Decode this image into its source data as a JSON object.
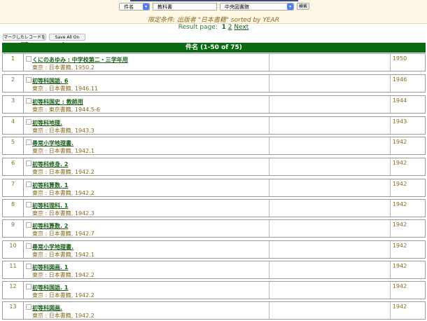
{
  "search": {
    "field_select": "件名",
    "query_value": "教科書",
    "library_select": "中央図書館",
    "search_button": "検索"
  },
  "query_line": "限定条件: 出版者 \"日本書籍\" sorted by YEAR",
  "result_page": {
    "label": "Result page:",
    "current": "1",
    "page2": "2",
    "next": "Next"
  },
  "actions": {
    "save_marked": "マークしたレコードを保存",
    "save_all": "Save All On Page"
  },
  "table_header": "件名 (1-50 of 75)",
  "rows": [
    {
      "num": "1",
      "title": "くにのあゆみ : 中学校第二・三学年用",
      "pub": "東京 : 日本書籍, 1950.2",
      "year": "1950"
    },
    {
      "num": "2",
      "title": "初等科国語. 6",
      "pub": "東京 : 日本書籍, 1946.11",
      "year": "1946"
    },
    {
      "num": "3",
      "title": "初等科国史 : 教師用",
      "pub": "東京 : 東京書籍, 1944.5-6",
      "year": "1944"
    },
    {
      "num": "4",
      "title": "初等科地理.",
      "pub": "東京 : 日本書籍, 1943.3",
      "year": "1943"
    },
    {
      "num": "5",
      "title": "尋常小学地理書.",
      "pub": "東京 : 日本書籍, 1942.1",
      "year": "1942"
    },
    {
      "num": "6",
      "title": "初等科修身. 2",
      "pub": "東京 : 日本書籍, 1942.2",
      "year": "1942"
    },
    {
      "num": "7",
      "title": "初等科算数. 1",
      "pub": "東京 : 日本書籍, 1942.2",
      "year": "1942"
    },
    {
      "num": "8",
      "title": "初等科理科. 1",
      "pub": "東京 : 日本書籍, 1942.3",
      "year": "1942"
    },
    {
      "num": "9",
      "title": "初等科算数. 2",
      "pub": "東京 : 日本書籍, 1942.7",
      "year": "1942"
    },
    {
      "num": "10",
      "title": "尋常小学地理書.",
      "pub": "東京 : 日本書籍, 1942.1",
      "year": "1942"
    },
    {
      "num": "11",
      "title": "初等科図画. 1",
      "pub": "東京 : 日本書籍, 1942.2",
      "year": "1942"
    },
    {
      "num": "12",
      "title": "初等科国語. 1",
      "pub": "東京 : 日本書籍, 1942.2",
      "year": "1942"
    },
    {
      "num": "13",
      "title": "初等科図画.",
      "pub": "東京 : 日本書籍, 1942.2",
      "year": "1942"
    }
  ]
}
